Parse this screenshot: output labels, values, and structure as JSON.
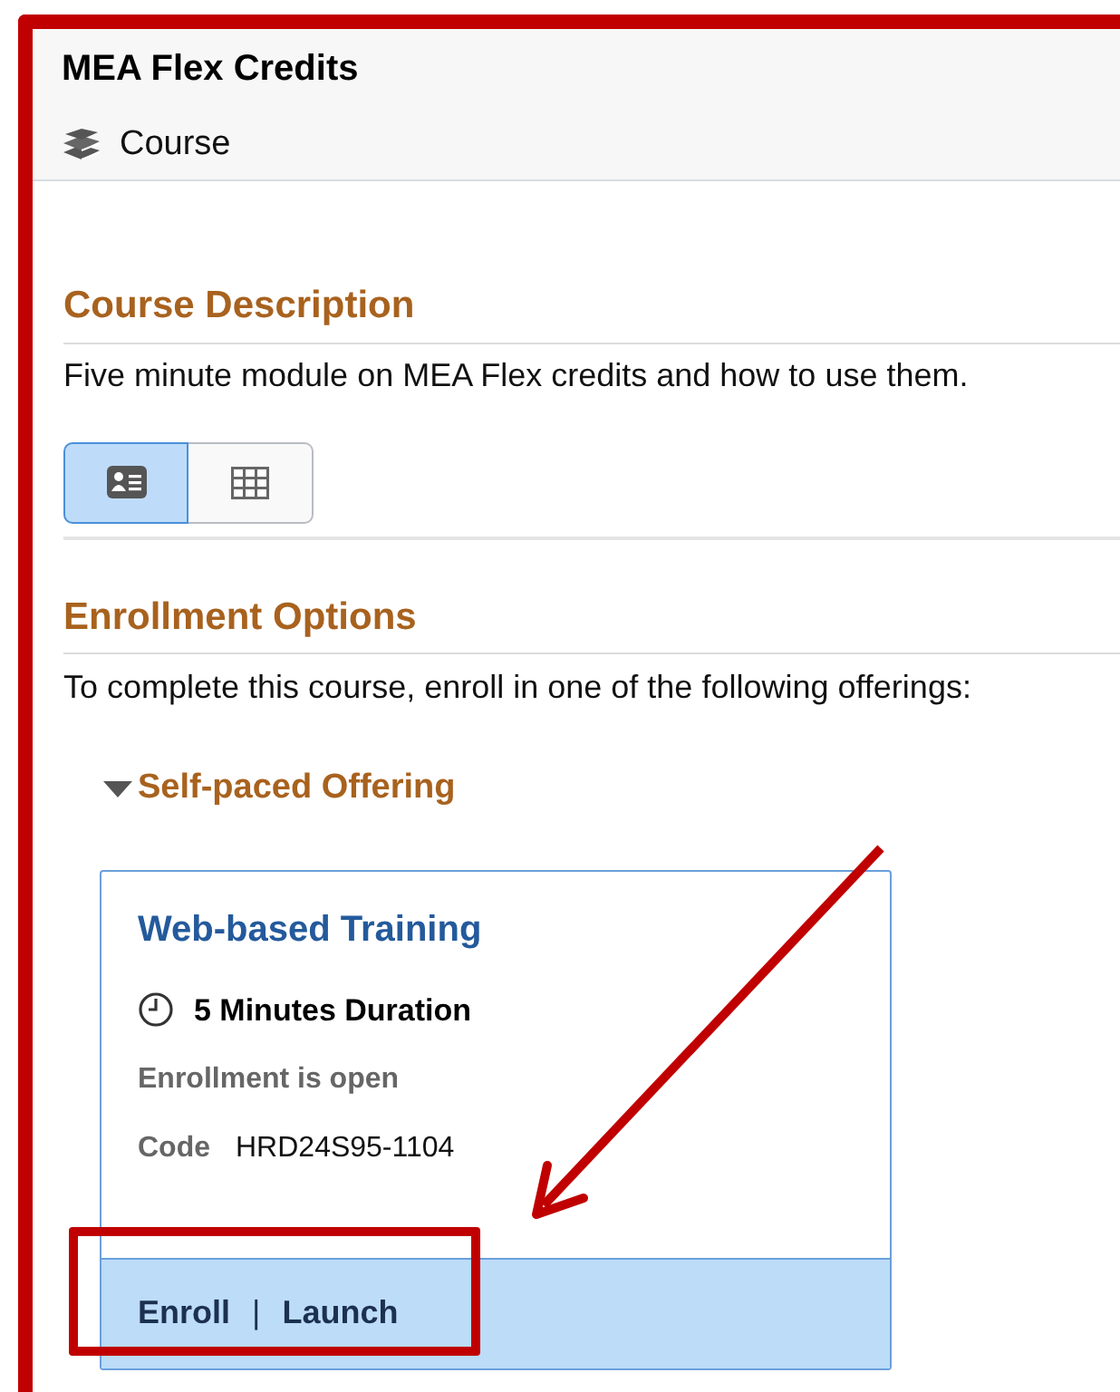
{
  "header": {
    "title": "MEA Flex Credits",
    "type_label": "Course"
  },
  "course_description": {
    "heading": "Course Description",
    "text": "Five minute module on MEA Flex credits and how to use them."
  },
  "view_toggle": [
    {
      "kind": "card",
      "selected": true
    },
    {
      "kind": "grid",
      "selected": false
    }
  ],
  "enrollment_options": {
    "heading": "Enrollment Options",
    "text": "To complete this course, enroll in one of the following offerings:",
    "offering_group": {
      "label": "Self-paced Offering",
      "expanded": true,
      "offerings": [
        {
          "title": "Web-based Training",
          "duration": "5 Minutes Duration",
          "status": "Enrollment is open",
          "code_label": "Code",
          "code": "HRD24S95-1104",
          "actions": [
            "Enroll",
            "Launch"
          ],
          "separator": "|"
        }
      ]
    }
  }
}
